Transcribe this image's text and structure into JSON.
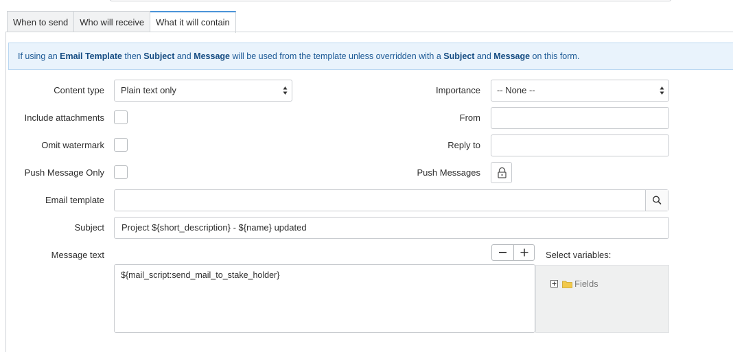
{
  "tabs": [
    {
      "label": "When to send",
      "active": false
    },
    {
      "label": "Who will receive",
      "active": false
    },
    {
      "label": "What it will contain",
      "active": true
    }
  ],
  "banner": {
    "t1": "If using an ",
    "b1": "Email Template",
    "t2": " then ",
    "b2": "Subject",
    "t3": " and ",
    "b3": "Message",
    "t4": " will be used from the template unless overridden with a ",
    "b4": "Subject",
    "t5": " and ",
    "b5": "Message",
    "t6": " on this form."
  },
  "form": {
    "content_type": {
      "label": "Content type",
      "value": "Plain text only"
    },
    "include_attachments": {
      "label": "Include attachments",
      "checked": false
    },
    "omit_watermark": {
      "label": "Omit watermark",
      "checked": false
    },
    "push_message_only": {
      "label": "Push Message Only",
      "checked": false
    },
    "email_template": {
      "label": "Email template",
      "value": ""
    },
    "subject": {
      "label": "Subject",
      "value": "Project ${short_description} - ${name} updated"
    },
    "message_text": {
      "label": "Message text",
      "value": "${mail_script:send_mail_to_stake_holder}"
    },
    "importance": {
      "label": "Importance",
      "value": "-- None --"
    },
    "from": {
      "label": "From",
      "value": ""
    },
    "reply_to": {
      "label": "Reply to",
      "value": ""
    },
    "push_messages": {
      "label": "Push Messages"
    },
    "select_variables": {
      "label": "Select variables:",
      "tree_root": "Fields"
    }
  },
  "icons": {
    "select_arrows": "updown-arrows-icon",
    "lock": "lock-icon",
    "search": "search-icon",
    "minus": "minus-icon",
    "plus": "plus-icon",
    "tree_expand": "plus-box-icon",
    "folder": "folder-icon"
  },
  "colors": {
    "active_tab_accent": "#4a93d8",
    "banner_background": "#e9f3fc",
    "banner_text": "#1d5a96",
    "folder": "#f2c94c"
  }
}
